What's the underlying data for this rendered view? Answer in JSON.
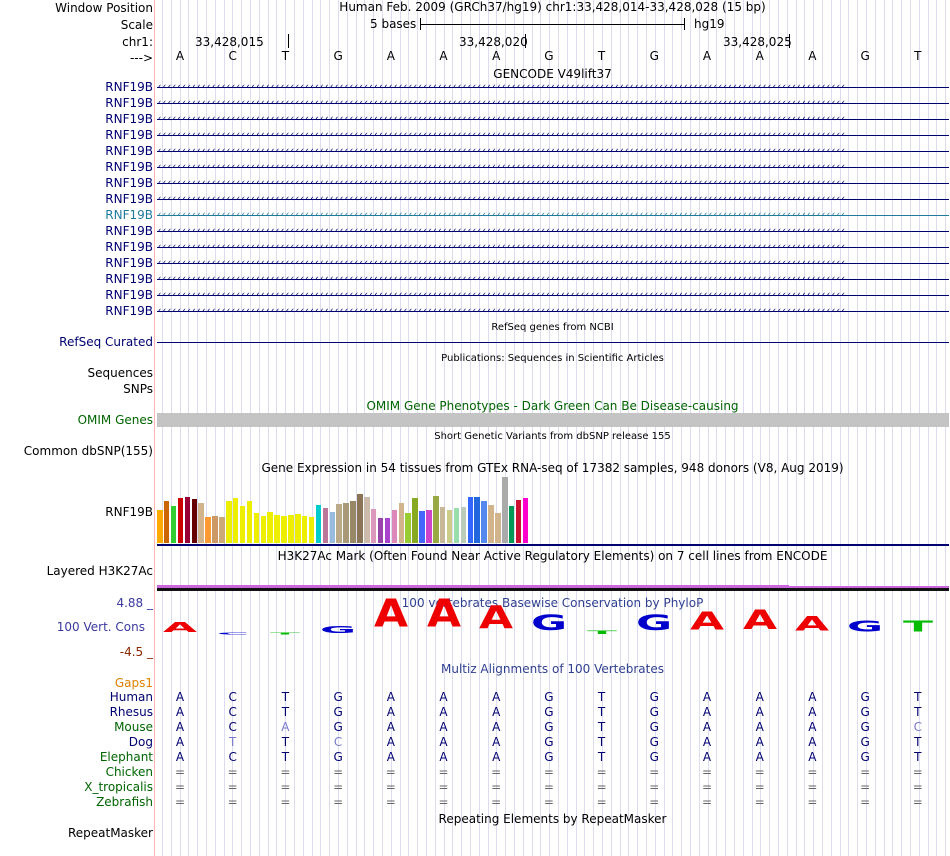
{
  "header": {
    "window_position_label": "Window Position",
    "scale_label": "Scale",
    "chrom_label": "chr1:",
    "arrow_label": "--->",
    "assembly_text": "Human Feb. 2009 (GRCh37/hg19)   chr1:33,428,014-33,428,028 (15 bp)",
    "scale_text": "5 bases",
    "db_text": "hg19",
    "coord1": "33,428,015",
    "coord2": "33,428,020",
    "coord3": "33,428,025"
  },
  "sequence": [
    "A",
    "C",
    "T",
    "G",
    "A",
    "A",
    "A",
    "G",
    "T",
    "G",
    "A",
    "A",
    "A",
    "G",
    "T"
  ],
  "gencode": {
    "title": "GENCODE V49lift37",
    "transcripts": [
      "RNF19B",
      "RNF19B",
      "RNF19B",
      "RNF19B",
      "RNF19B",
      "RNF19B",
      "RNF19B",
      "RNF19B",
      "RNF19B",
      "RNF19B",
      "RNF19B",
      "RNF19B",
      "RNF19B",
      "RNF19B",
      "RNF19B"
    ],
    "highlight_index": 8,
    "highlight_color": "#1f7a9c",
    "gene_color": "#000070"
  },
  "refseq": {
    "title": "RefSeq genes from NCBI",
    "label": "RefSeq Curated"
  },
  "publications": {
    "title": "Publications: Sequences in Scientific Articles",
    "label1": "Sequences",
    "label2": "SNPs"
  },
  "omim": {
    "title": "OMIM Gene Phenotypes - Dark Green Can Be Disease-causing",
    "label": "OMIM Genes",
    "title_color": "#006400"
  },
  "dbsnp": {
    "title": "Short Genetic Variants from dbSNP release 155",
    "label": "Common dbSNP(155)"
  },
  "gtex": {
    "title": "Gene Expression in 54 tissues from GTEx RNA-seq of 17382 samples, 948 donors (V8, Aug 2019)",
    "label": "RNF19B",
    "bars": [
      {
        "h": 0.33,
        "c": "#ffaa00"
      },
      {
        "h": 0.42,
        "c": "#cc6600"
      },
      {
        "h": 0.37,
        "c": "#33cc33"
      },
      {
        "h": 0.45,
        "c": "#cc0000"
      },
      {
        "h": 0.46,
        "c": "#990033"
      },
      {
        "h": 0.44,
        "c": "#660000"
      },
      {
        "h": 0.4,
        "c": "#d2b48c"
      },
      {
        "h": 0.26,
        "c": "#ff9933"
      },
      {
        "h": 0.27,
        "c": "#cc9966"
      },
      {
        "h": 0.26,
        "c": "#ccaa77"
      },
      {
        "h": 0.42,
        "c": "#eeee00"
      },
      {
        "h": 0.45,
        "c": "#eeee00"
      },
      {
        "h": 0.37,
        "c": "#eeee00"
      },
      {
        "h": 0.42,
        "c": "#eeee00"
      },
      {
        "h": 0.3,
        "c": "#eeee00"
      },
      {
        "h": 0.27,
        "c": "#eeee00"
      },
      {
        "h": 0.31,
        "c": "#eeee00"
      },
      {
        "h": 0.28,
        "c": "#eeee00"
      },
      {
        "h": 0.27,
        "c": "#eeee00"
      },
      {
        "h": 0.28,
        "c": "#eeee00"
      },
      {
        "h": 0.29,
        "c": "#eeee00"
      },
      {
        "h": 0.27,
        "c": "#eeee00"
      },
      {
        "h": 0.26,
        "c": "#eeee00"
      },
      {
        "h": 0.38,
        "c": "#00cccc"
      },
      {
        "h": 0.35,
        "c": "#bb7799"
      },
      {
        "h": 0.31,
        "c": "#99bbdd"
      },
      {
        "h": 0.39,
        "c": "#bbaa88"
      },
      {
        "h": 0.4,
        "c": "#aa9977"
      },
      {
        "h": 0.42,
        "c": "#998866"
      },
      {
        "h": 0.49,
        "c": "#8b7355"
      },
      {
        "h": 0.46,
        "c": "#ccbbaa"
      },
      {
        "h": 0.34,
        "c": "#dd99bb"
      },
      {
        "h": 0.25,
        "c": "#9944aa"
      },
      {
        "h": 0.25,
        "c": "#aa44cc"
      },
      {
        "h": 0.33,
        "c": "#dd88bb"
      },
      {
        "h": 0.4,
        "c": "#d2b48c"
      },
      {
        "h": 0.3,
        "c": "#99cc33"
      },
      {
        "h": 0.45,
        "c": "#88aa22"
      },
      {
        "h": 0.32,
        "c": "#4466ff"
      },
      {
        "h": 0.33,
        "c": "#cc44cc"
      },
      {
        "h": 0.47,
        "c": "#99aa44"
      },
      {
        "h": 0.36,
        "c": "#c8b89a"
      },
      {
        "h": 0.33,
        "c": "#cccc88"
      },
      {
        "h": 0.35,
        "c": "#99ddaa"
      },
      {
        "h": 0.36,
        "c": "#bbccbb"
      },
      {
        "h": 0.46,
        "c": "#3366ff"
      },
      {
        "h": 0.46,
        "c": "#2266dd"
      },
      {
        "h": 0.42,
        "c": "#5588ee"
      },
      {
        "h": 0.38,
        "c": "#d2b48c"
      },
      {
        "h": 0.3,
        "c": "#d2b48c"
      },
      {
        "h": 0.66,
        "c": "#aaaaaa"
      },
      {
        "h": 0.37,
        "c": "#009955"
      },
      {
        "h": 0.43,
        "c": "#cc1133"
      },
      {
        "h": 0.45,
        "c": "#ff00cc"
      }
    ]
  },
  "h3k27ac": {
    "title": "H3K27Ac Mark (Often Found Near Active Regulatory Elements) on 7 cell lines from ENCODE",
    "label": "Layered H3K27Ac"
  },
  "conservation": {
    "title": "100 vertebrates Basewise Conservation by PhyloP",
    "label": "100 Vert. Cons",
    "max_label": "4.88 _",
    "min_label": "-4.5 _",
    "scores": [
      0.35,
      0.0,
      0.05,
      0.25,
      1.0,
      1.0,
      0.8,
      0.55,
      0.1,
      0.55,
      0.65,
      0.7,
      0.5,
      0.4,
      0.4
    ]
  },
  "multiz": {
    "title": "Multiz Alignments of 100 Vertebrates",
    "gaps_label": "Gaps1",
    "species": [
      {
        "name": "Human",
        "seq": [
          "A",
          "C",
          "T",
          "G",
          "A",
          "A",
          "A",
          "G",
          "T",
          "G",
          "A",
          "A",
          "A",
          "G",
          "T"
        ],
        "color": "#000070"
      },
      {
        "name": "Rhesus",
        "seq": [
          "A",
          "C",
          "T",
          "G",
          "A",
          "A",
          "A",
          "G",
          "T",
          "G",
          "A",
          "A",
          "A",
          "G",
          "T"
        ],
        "color": "#000070"
      },
      {
        "name": "Mouse",
        "seq": [
          "A",
          "C",
          "A",
          "G",
          "A",
          "A",
          "A",
          "G",
          "T",
          "G",
          "A",
          "A",
          "A",
          "G",
          "C"
        ],
        "color": "#006400"
      },
      {
        "name": "Dog",
        "seq": [
          "A",
          "T",
          "T",
          "C",
          "A",
          "A",
          "A",
          "G",
          "T",
          "G",
          "A",
          "A",
          "A",
          "G",
          "T"
        ],
        "color": "#000070"
      },
      {
        "name": "Elephant",
        "seq": [
          "A",
          "C",
          "T",
          "G",
          "A",
          "A",
          "A",
          "G",
          "T",
          "G",
          "A",
          "A",
          "A",
          "G",
          "T"
        ],
        "color": "#006400"
      },
      {
        "name": "Chicken",
        "seq": [
          "=",
          "=",
          "=",
          "=",
          "=",
          "=",
          "=",
          "=",
          "=",
          "=",
          "=",
          "=",
          "=",
          "=",
          "="
        ],
        "color": "#006400"
      },
      {
        "name": "X_tropicalis",
        "seq": [
          "=",
          "=",
          "=",
          "=",
          "=",
          "=",
          "=",
          "=",
          "=",
          "=",
          "=",
          "=",
          "=",
          "=",
          "="
        ],
        "color": "#006400"
      },
      {
        "name": "Zebrafish",
        "seq": [
          "=",
          "=",
          "=",
          "=",
          "=",
          "=",
          "=",
          "=",
          "=",
          "=",
          "=",
          "=",
          "=",
          "=",
          "="
        ],
        "color": "#006400"
      }
    ]
  },
  "repeatmasker": {
    "title": "Repeating Elements by RepeatMasker",
    "label": "RepeatMasker"
  },
  "colors": {
    "navy": "#000070",
    "green": "#006400",
    "orange": "#e0a000",
    "gridline": "#dcdcf0",
    "cursor": "#ff9999"
  }
}
